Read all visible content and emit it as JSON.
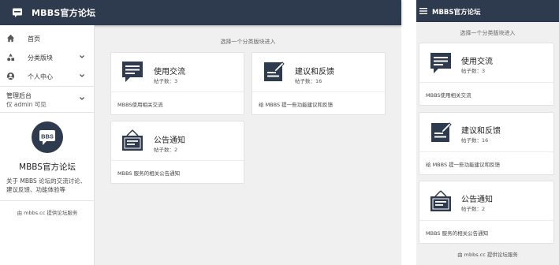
{
  "app": {
    "title": "MBBS官方论坛",
    "logo_text": "BBS"
  },
  "sidebar": {
    "items": [
      {
        "label": "首页",
        "icon": "home-icon"
      },
      {
        "label": "分类版块",
        "icon": "shapes-icon"
      },
      {
        "label": "个人中心",
        "icon": "account-icon"
      }
    ],
    "admin": {
      "title": "管理后台",
      "subtitle": "仅 admin 可见"
    },
    "forum_name": "MBBS官方论坛",
    "forum_desc": "关于 MBBS 论坛的交流讨论、建议反馈、功能体验等",
    "footer": "由 mbbs.cc 提供论坛服务"
  },
  "main": {
    "hint": "选择一个分类版块进入",
    "categories": [
      {
        "name": "使用交流",
        "count": "帖子数：3",
        "desc": "MBBS使用相关交流",
        "icon": "chat-icon"
      },
      {
        "name": "建议和反馈",
        "count": "帖子数：16",
        "desc": "给 MBBS 提一些功能建议和反馈",
        "icon": "feedback-icon"
      },
      {
        "name": "公告通知",
        "count": "帖子数：2",
        "desc": "MBBS 服务的相关公告通知",
        "icon": "notice-icon"
      }
    ]
  },
  "mobile": {
    "title": "MBBS官方论坛",
    "hint": "选择一个分类版块进入",
    "footer": "由 mbbs.cc 提供论坛服务"
  },
  "colors": {
    "header": "#2e3b4e",
    "background": "#f0f0f0",
    "card": "#ffffff"
  }
}
